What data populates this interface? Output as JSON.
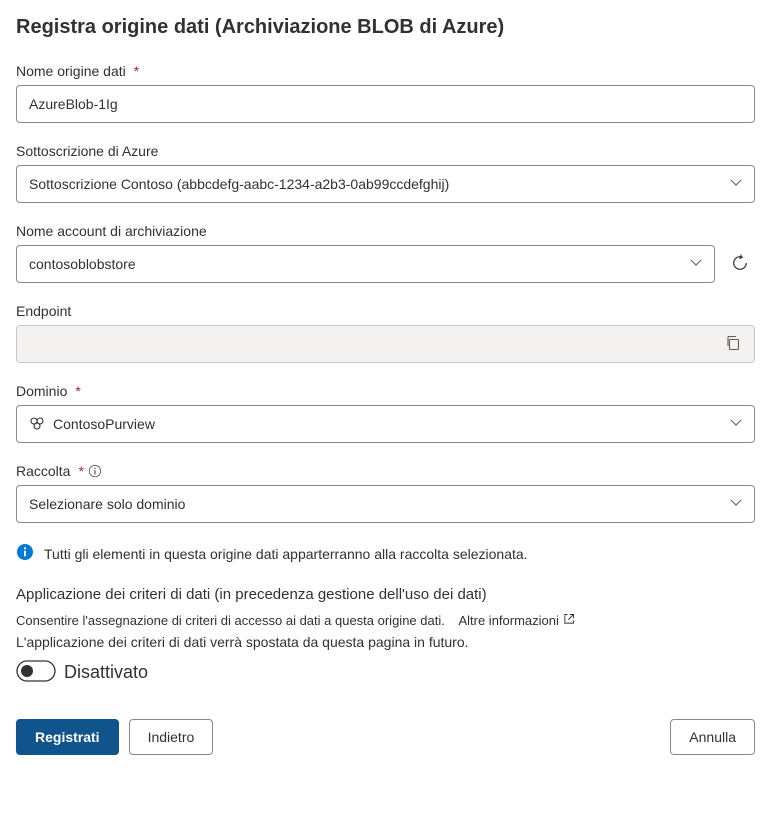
{
  "title": "Registra origine dati (Archiviazione BLOB di Azure)",
  "fields": {
    "dataSourceName": {
      "label": "Nome origine dati",
      "value": "AzureBlob-1Ig"
    },
    "subscription": {
      "label": "Sottoscrizione di Azure",
      "value": "Sottoscrizione Contoso (abbcdefg-aabc-1234-a2b3-0ab99ccdefghij)"
    },
    "storageAccount": {
      "label": "Nome account di archiviazione",
      "value": "contosoblobstore"
    },
    "endpoint": {
      "label": "Endpoint",
      "value": ""
    },
    "domain": {
      "label": "Dominio",
      "value": "ContosoPurview"
    },
    "collection": {
      "label": "Raccolta",
      "value": "Selezionare solo dominio"
    }
  },
  "infoMessage": "Tutti gli elementi in questa origine dati apparterranno alla raccolta selezionata.",
  "policy": {
    "heading": "Applicazione dei criteri di dati (in precedenza gestione dell'uso dei dati)",
    "sub": "Consentire l'assegnazione di criteri di accesso ai dati a questa origine dati.",
    "moreInfo": "Altre informazioni",
    "note": "L'applicazione dei criteri di dati verrà spostata da questa pagina in futuro.",
    "toggleState": "Disattivato"
  },
  "buttons": {
    "register": "Registrati",
    "back": "Indietro",
    "cancel": "Annulla"
  }
}
